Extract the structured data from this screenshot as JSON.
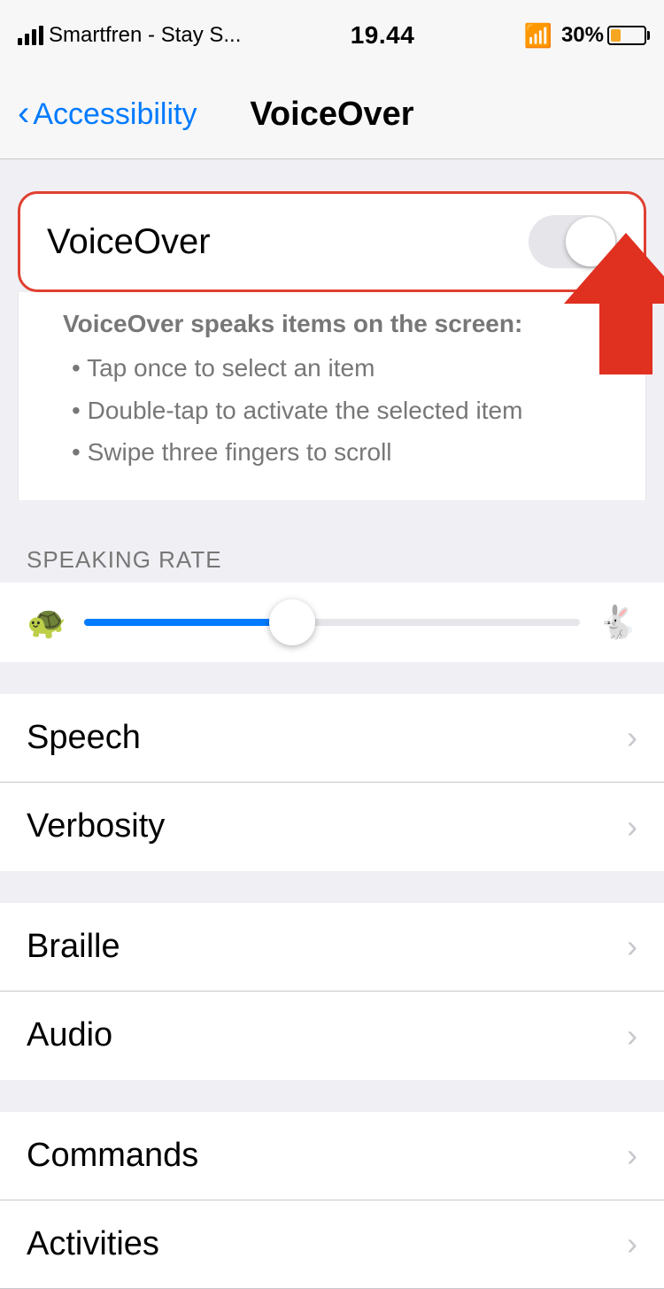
{
  "statusBar": {
    "carrier": "Smartfren - Stay S...",
    "wifi": true,
    "time": "19.44",
    "battery": "30%"
  },
  "navBar": {
    "backLabel": "Accessibility",
    "title": "VoiceOver"
  },
  "voiceoverToggle": {
    "label": "VoiceOver",
    "isOn": false
  },
  "voiceoverDescription": {
    "title": "VoiceOver speaks items on the screen:",
    "items": [
      "Tap once to select an item",
      "Double-tap to activate the selected item",
      "Swipe three fingers to scroll"
    ]
  },
  "speakingRate": {
    "sectionHeader": "SPEAKING RATE",
    "sliderValue": 42,
    "slowIcon": "🐢",
    "fastIcon": "🐇"
  },
  "menuItems": [
    {
      "label": "Speech",
      "hasChevron": true
    },
    {
      "label": "Verbosity",
      "hasChevron": true
    },
    {
      "label": "Braille",
      "hasChevron": true
    },
    {
      "label": "Audio",
      "hasChevron": true
    },
    {
      "label": "Commands",
      "hasChevron": true
    },
    {
      "label": "Activities",
      "hasChevron": true
    }
  ]
}
